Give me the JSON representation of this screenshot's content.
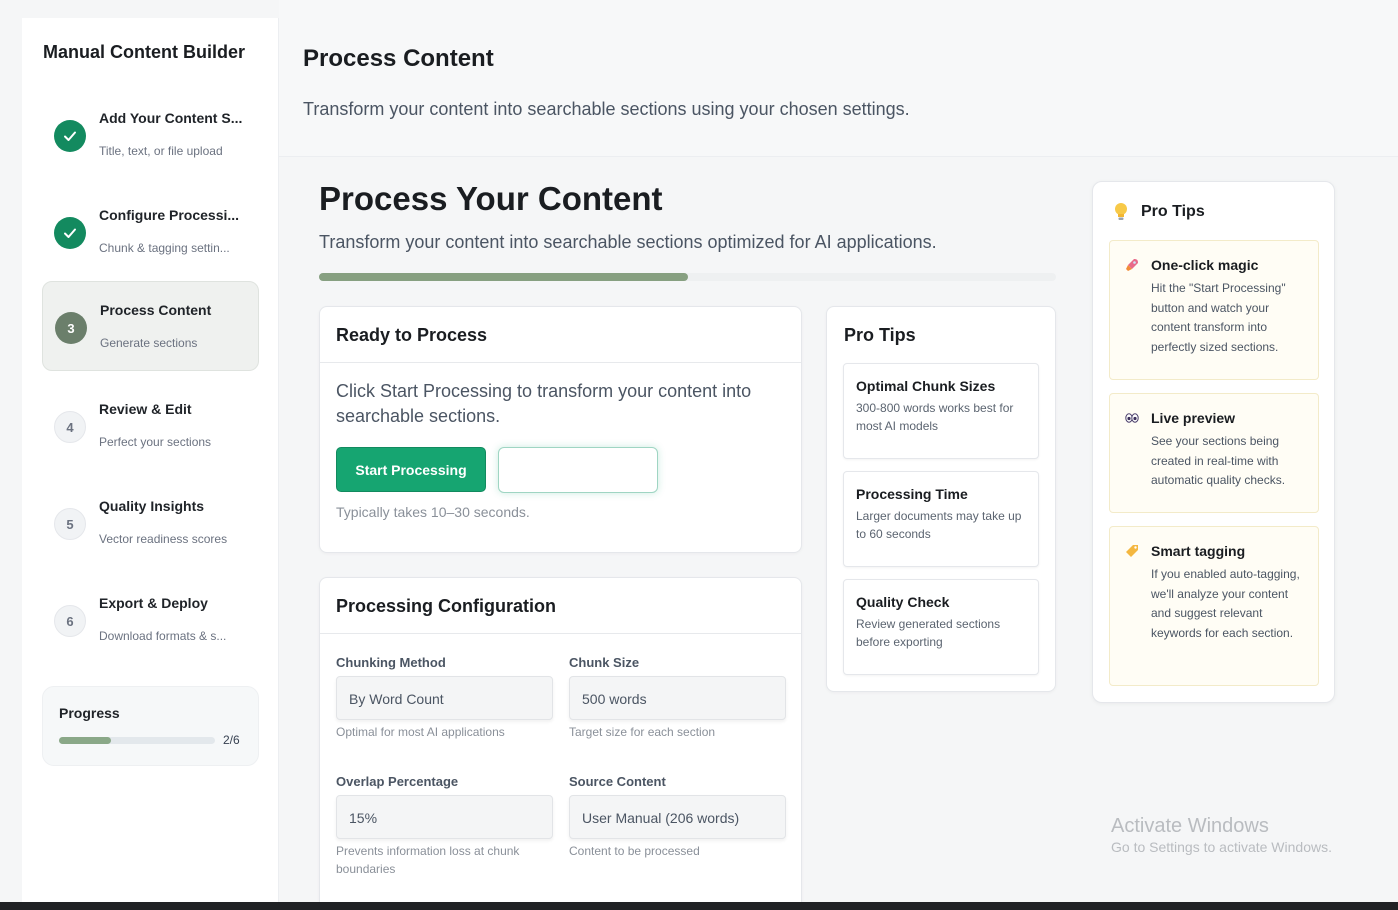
{
  "sidebar": {
    "title": "Manual Content Builder",
    "steps": [
      {
        "number": "",
        "label": "Add Your Content S...",
        "sub": "Title, text, or file upload",
        "state": "done"
      },
      {
        "number": "",
        "label": "Configure Processi...",
        "sub": "Chunk & tagging settin...",
        "state": "done"
      },
      {
        "number": "3",
        "label": "Process Content",
        "sub": "Generate sections",
        "state": "current"
      },
      {
        "number": "4",
        "label": "Review & Edit",
        "sub": "Perfect your sections",
        "state": "todo"
      },
      {
        "number": "5",
        "label": "Quality Insights",
        "sub": "Vector readiness scores",
        "state": "todo"
      },
      {
        "number": "6",
        "label": "Export & Deploy",
        "sub": "Download formats & s...",
        "state": "todo"
      }
    ],
    "progress": {
      "title": "Progress",
      "count": "2/6",
      "fraction": 0.3333
    }
  },
  "header": {
    "title": "Process Content",
    "description": "Transform your content into searchable sections using your chosen settings."
  },
  "main": {
    "title": "Process Your Content",
    "description": "Transform your content into searchable sections optimized for AI applications.",
    "progress_fraction": 0.5
  },
  "ready": {
    "title": "Ready to Process",
    "text": "Click Start Processing to transform your content into searchable sections.",
    "start_button": "Start Processing",
    "hint": "Typically takes 10–30 seconds."
  },
  "config": {
    "title": "Processing Configuration",
    "fields": [
      {
        "label": "Chunking Method",
        "value": "By Word Count",
        "help": "Optimal for most AI applications"
      },
      {
        "label": "Chunk Size",
        "value": "500 words",
        "help": "Target size for each section"
      },
      {
        "label": "Overlap Percentage",
        "value": "15%",
        "help": "Prevents information loss at chunk boundaries"
      },
      {
        "label": "Source Content",
        "value": "User Manual (206 words)",
        "help": "Content to be processed"
      }
    ]
  },
  "pro_tips_small": {
    "title": "Pro Tips",
    "items": [
      {
        "title": "Optimal Chunk Sizes",
        "desc": "300-800 words works best for most AI models"
      },
      {
        "title": "Processing Time",
        "desc": "Larger documents may take up to 60 seconds"
      },
      {
        "title": "Quality Check",
        "desc": "Review generated sections before exporting"
      }
    ]
  },
  "pro_tips_panel": {
    "title": "Pro Tips",
    "icon": "lightbulb-icon",
    "items": [
      {
        "icon": "rocket-icon",
        "title": "One-click magic",
        "desc": "Hit the \"Start Processing\" button and watch your content transform into perfectly sized sections."
      },
      {
        "icon": "eyes-icon",
        "title": "Live preview",
        "desc": "See your sections being created in real-time with automatic quality checks."
      },
      {
        "icon": "tag-icon",
        "title": "Smart tagging",
        "desc": "If you enabled auto-tagging, we'll analyze your content and suggest relevant keywords for each section."
      }
    ]
  },
  "watermark": {
    "title": "Activate Windows",
    "subtitle": "Go to Settings to activate Windows."
  },
  "colors": {
    "accent_green": "#16a571",
    "done_green": "#138a5f",
    "current_step": "#6b7f6b",
    "progress_fill": "#8aa888",
    "tip_bg": "#fffdf5"
  }
}
